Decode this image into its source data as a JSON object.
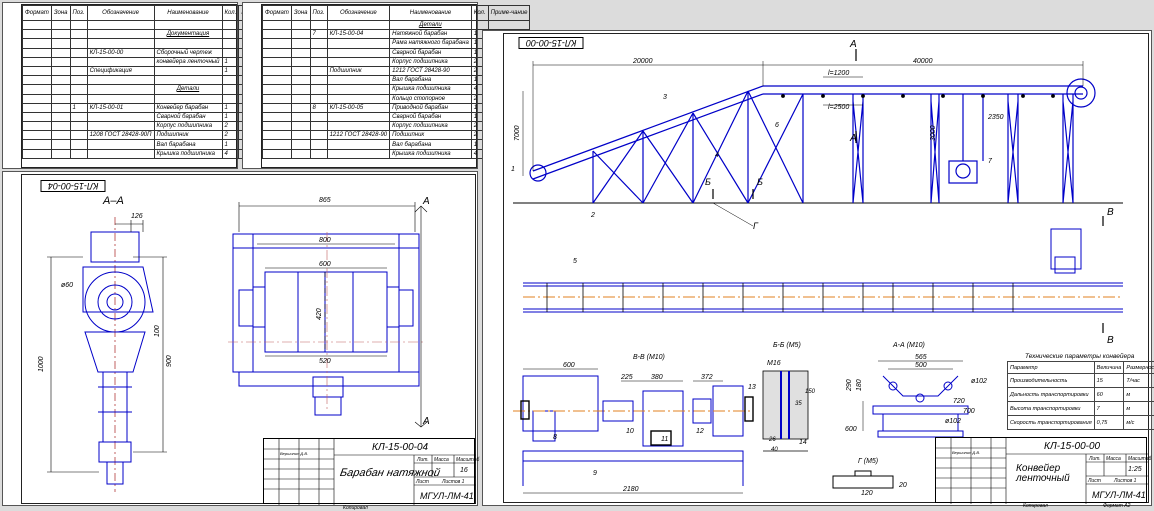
{
  "specSheet1": {
    "headers": [
      "Формат",
      "Зона",
      "Поз.",
      "Обозначение",
      "Наименование",
      "Кол.",
      "Приме-чание"
    ],
    "rows": [
      [
        "",
        "",
        "",
        "",
        "",
        "",
        ""
      ],
      [
        "",
        "",
        "",
        "",
        "Документация",
        "",
        ""
      ],
      [
        "",
        "",
        "",
        "",
        "",
        "",
        ""
      ],
      [
        "",
        "",
        "",
        "КЛ-15-00-00",
        "Сборочный чертеж",
        "",
        ""
      ],
      [
        "",
        "",
        "",
        "",
        "конвейера ленточный",
        "1",
        ""
      ],
      [
        "",
        "",
        "",
        "Спецификация",
        "",
        "1",
        ""
      ],
      [
        "",
        "",
        "",
        "",
        "",
        "",
        ""
      ],
      [
        "",
        "",
        "",
        "",
        "Детали",
        "",
        ""
      ],
      [
        "",
        "",
        "",
        "",
        "",
        "",
        ""
      ],
      [
        "",
        "",
        "1",
        "КЛ-15-00-01",
        "Конвейер барабан",
        "1",
        ""
      ],
      [
        "",
        "",
        "",
        "",
        "Сварной барабан",
        "1",
        ""
      ],
      [
        "",
        "",
        "",
        "",
        "Корпус подшипника",
        "2",
        ""
      ],
      [
        "",
        "",
        "",
        "1208 ГОСТ 28428-90П",
        "Подшипник",
        "2",
        ""
      ],
      [
        "",
        "",
        "",
        "",
        "Вал барабана",
        "1",
        ""
      ],
      [
        "",
        "",
        "",
        "",
        "Крышка подшипника",
        "4",
        ""
      ]
    ]
  },
  "specSheet2": {
    "headers": [
      "Формат",
      "Зона",
      "Поз.",
      "Обозначение",
      "Наименование",
      "Кол.",
      "Приме-чание"
    ],
    "rows": [
      [
        "",
        "",
        "",
        "",
        "Детали",
        "",
        ""
      ],
      [
        "",
        "",
        "7",
        "КЛ-15-00-04",
        "Натяжной барабан",
        "1",
        ""
      ],
      [
        "",
        "",
        "",
        "",
        "Рама натяжного барабана",
        "1",
        ""
      ],
      [
        "",
        "",
        "",
        "",
        "Сварной барабан",
        "1",
        ""
      ],
      [
        "",
        "",
        "",
        "",
        "Корпус подшипника",
        "2",
        ""
      ],
      [
        "",
        "",
        "",
        "Подшипник",
        "1212 ГОСТ 28428-90",
        "2",
        ""
      ],
      [
        "",
        "",
        "",
        "",
        "Вал барабана",
        "1",
        ""
      ],
      [
        "",
        "",
        "",
        "",
        "Крышка подшипника",
        "4",
        ""
      ],
      [
        "",
        "",
        "",
        "",
        "Кольцо стопорное",
        "2",
        ""
      ],
      [
        "",
        "",
        "8",
        "КЛ-15-00-05",
        "Приводной барабан",
        "1",
        ""
      ],
      [
        "",
        "",
        "",
        "",
        "Сварной барабан",
        "1",
        ""
      ],
      [
        "",
        "",
        "",
        "",
        "Корпус подшипника",
        "2",
        ""
      ],
      [
        "",
        "",
        "",
        "1212 ГОСТ 28428-90",
        "Подшипник",
        "2",
        ""
      ],
      [
        "",
        "",
        "",
        "",
        "Вал барабана",
        "1",
        ""
      ],
      [
        "",
        "",
        "",
        "",
        "Крышка подшипника",
        "4",
        ""
      ]
    ]
  },
  "drawingLeft": {
    "code_rotated": "КЛ-15-00-04",
    "section_label": "А–А",
    "dims": {
      "d126": "126",
      "d60": "ø60",
      "d100": "100",
      "d900": "900",
      "d1000": "1000",
      "d865": "865",
      "d800": "800",
      "d600": "600",
      "d420": "420",
      "d520": "520"
    },
    "section_marker_a": "А",
    "stamp": {
      "code": "КЛ-15-00-04",
      "title": "Барабан натяжной",
      "scale": "16",
      "org": "МГУЛ-ЛМ-41",
      "lit_hdr": "Лит.",
      "mass_hdr": "Масса",
      "scale_hdr": "Масштаб",
      "sheet": "Лист",
      "sheets": "Листов 1",
      "row_labels": [
        "Изм.",
        "Лист",
        "№ докум.",
        "Подп.",
        "Дата",
        "Разраб.",
        "Провер.",
        "Т.контр.",
        "Н.контр.",
        "Утв."
      ],
      "dev_name": "Вершинин Д.В.",
      "footer_copy": "Копировал",
      "footer_format": "Формат А2"
    }
  },
  "drawingRight": {
    "code_rotated": "КЛ-15-00-00",
    "dims_top": {
      "d20000": "20000",
      "d40000": "40000",
      "l1200": "l=1200",
      "l2500": "l=2500",
      "d7000": "7000",
      "d3000": "3000",
      "d2350": "2350",
      "d2180": "2180"
    },
    "positions": [
      "1",
      "2",
      "3",
      "4",
      "5",
      "6",
      "7",
      "8",
      "9",
      "10",
      "11",
      "12",
      "13",
      "14"
    ],
    "markers": {
      "A": "А",
      "B": "Б",
      "V": "В",
      "G": "Г"
    },
    "views": {
      "vv": "В-В (М10)",
      "bb": "Б-Б (М5)",
      "aa": "А-А (М10)",
      "g": "Г (М5)"
    },
    "view_dims": {
      "d600": "600",
      "d225": "225",
      "d380": "380",
      "d372": "372",
      "m16": "М16",
      "d565": "565",
      "d500": "500",
      "d720": "720",
      "d700": "700",
      "d290": "290",
      "d180": "180",
      "d600b": "600",
      "d102": "ø102",
      "d102b": "ø102",
      "d26": "26",
      "d40": "40",
      "d120": "120",
      "d20": "20",
      "d35": "35",
      "d150": "150"
    },
    "params": {
      "title": "Технические параметры конвейера",
      "headers": [
        "Параметр",
        "Величина",
        "Размерность"
      ],
      "rows": [
        [
          "Производительность",
          "15",
          "Т/час"
        ],
        [
          "Дальность транспортировки",
          "60",
          "м"
        ],
        [
          "Высота транспортировки",
          "7",
          "м"
        ],
        [
          "Скорость транспортирования",
          "0,75",
          "м/с"
        ]
      ]
    },
    "stamp": {
      "code": "КЛ-15-00-00",
      "title": "Конвейер ленточный",
      "scale": "1:25",
      "org": "МГУЛ-ЛМ-41",
      "lit_hdr": "Лит.",
      "mass_hdr": "Масса",
      "scale_hdr": "Масштаб",
      "sheet": "Лист",
      "sheets": "Листов 1",
      "dev_name": "Вершинин Д.В.",
      "footer_copy": "Копировал",
      "footer_format": "Формат А2"
    }
  },
  "sidebar_labels": [
    "Перв. примен.",
    "Справ. №",
    "Подп. и дата",
    "Инв. № дубл.",
    "Взам. инв. №",
    "Подп. и дата",
    "Инв. № подл."
  ],
  "colors": {
    "line": "#000",
    "blue": "#0000c8",
    "bg": "#dcdcdc",
    "sheet": "#ffffff"
  }
}
